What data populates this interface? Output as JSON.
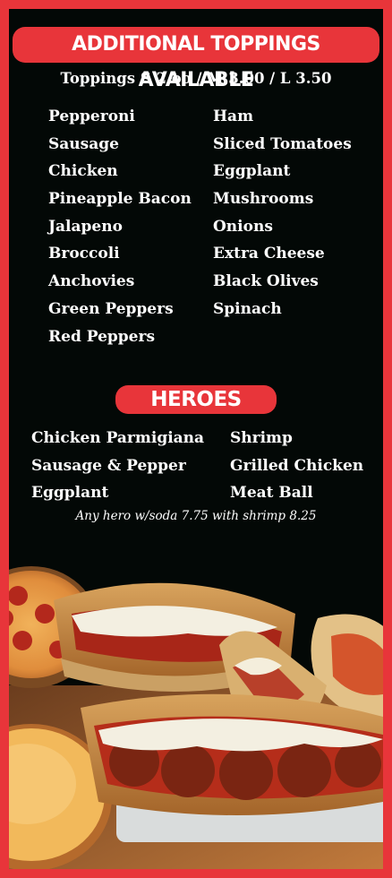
{
  "toppings": {
    "banner": "ADDITIONAL TOPPINGS AVAILABLE",
    "price_line": "Toppings S 2.oo / M 3.00 / L 3.50",
    "left": [
      "Pepperoni",
      "Sausage",
      "Chicken",
      "Pineapple Bacon",
      "Jalapeno",
      "Broccoli",
      "Anchovies",
      "Green Peppers",
      "Red Peppers"
    ],
    "right": [
      "Ham",
      "Sliced Tomatoes",
      "Eggplant",
      "Mushrooms",
      "Onions",
      "Extra Cheese",
      "Black Olives",
      "Spinach"
    ]
  },
  "heroes": {
    "banner": "HEROES",
    "left": [
      "Chicken Parmigiana",
      "Sausage & Pepper",
      "Eggplant"
    ],
    "right": [
      "Shrimp",
      "Grilled Chicken",
      "Meat Ball"
    ],
    "note": "Any hero w/soda 7.75 with shrimp 8.25"
  },
  "colors": {
    "accent": "#e8353a",
    "background": "#030806",
    "text": "#ffffff"
  }
}
